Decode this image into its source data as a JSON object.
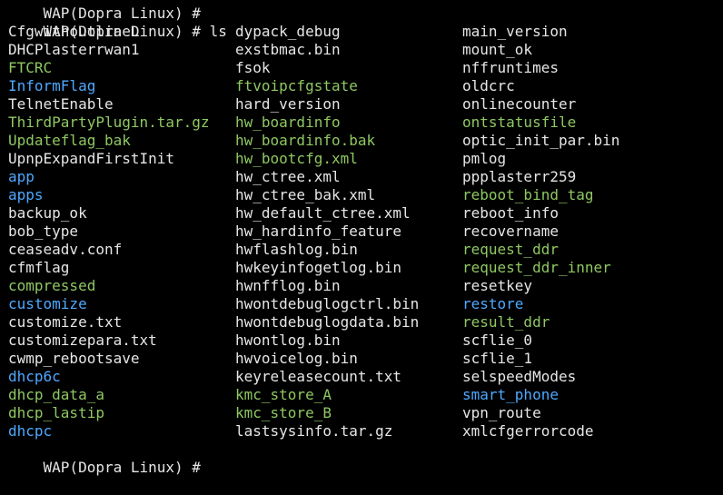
{
  "terminal": {
    "first_prompt": "WAP(Dopra Linux) # ",
    "prompt": "WAP(Dopra Linux) # ",
    "command": "ls",
    "last_prompt": "WAP(Dopra Linux) # ",
    "colors": {
      "background": "#000000",
      "foreground": "#e6e6e6",
      "directory": "#4fa8ff",
      "executable": "#8fc862"
    },
    "rows": [
      [
        {
          "name": "CfgwithoutlineD",
          "kind": "plain"
        },
        {
          "name": "dypack_debug",
          "kind": "plain"
        },
        {
          "name": "main_version",
          "kind": "plain"
        }
      ],
      [
        {
          "name": "DHCPlasterrwan1",
          "kind": "plain"
        },
        {
          "name": "exstbmac.bin",
          "kind": "plain"
        },
        {
          "name": "mount_ok",
          "kind": "plain"
        }
      ],
      [
        {
          "name": "FTCRC",
          "kind": "exe"
        },
        {
          "name": "fsok",
          "kind": "plain"
        },
        {
          "name": "nffruntimes",
          "kind": "plain"
        }
      ],
      [
        {
          "name": "InformFlag",
          "kind": "dir"
        },
        {
          "name": "ftvoipcfgstate",
          "kind": "exe"
        },
        {
          "name": "oldcrc",
          "kind": "plain"
        }
      ],
      [
        {
          "name": "TelnetEnable",
          "kind": "plain"
        },
        {
          "name": "hard_version",
          "kind": "plain"
        },
        {
          "name": "onlinecounter",
          "kind": "plain"
        }
      ],
      [
        {
          "name": "ThirdPartyPlugin.tar.gz",
          "kind": "exe"
        },
        {
          "name": "hw_boardinfo",
          "kind": "exe"
        },
        {
          "name": "ontstatusfile",
          "kind": "exe"
        }
      ],
      [
        {
          "name": "Updateflag_bak",
          "kind": "exe"
        },
        {
          "name": "hw_boardinfo.bak",
          "kind": "exe"
        },
        {
          "name": "optic_init_par.bin",
          "kind": "plain"
        }
      ],
      [
        {
          "name": "UpnpExpandFirstInit",
          "kind": "plain"
        },
        {
          "name": "hw_bootcfg.xml",
          "kind": "exe"
        },
        {
          "name": "pmlog",
          "kind": "plain"
        }
      ],
      [
        {
          "name": "app",
          "kind": "dir"
        },
        {
          "name": "hw_ctree.xml",
          "kind": "plain"
        },
        {
          "name": "ppplasterr259",
          "kind": "plain"
        }
      ],
      [
        {
          "name": "apps",
          "kind": "dir"
        },
        {
          "name": "hw_ctree_bak.xml",
          "kind": "plain"
        },
        {
          "name": "reboot_bind_tag",
          "kind": "exe"
        }
      ],
      [
        {
          "name": "backup_ok",
          "kind": "plain"
        },
        {
          "name": "hw_default_ctree.xml",
          "kind": "plain"
        },
        {
          "name": "reboot_info",
          "kind": "plain"
        }
      ],
      [
        {
          "name": "bob_type",
          "kind": "plain"
        },
        {
          "name": "hw_hardinfo_feature",
          "kind": "plain"
        },
        {
          "name": "recovername",
          "kind": "plain"
        }
      ],
      [
        {
          "name": "ceaseadv.conf",
          "kind": "plain"
        },
        {
          "name": "hwflashlog.bin",
          "kind": "plain"
        },
        {
          "name": "request_ddr",
          "kind": "exe"
        }
      ],
      [
        {
          "name": "cfmflag",
          "kind": "plain"
        },
        {
          "name": "hwkeyinfogetlog.bin",
          "kind": "plain"
        },
        {
          "name": "request_ddr_inner",
          "kind": "exe"
        }
      ],
      [
        {
          "name": "compressed",
          "kind": "exe"
        },
        {
          "name": "hwnfflog.bin",
          "kind": "plain"
        },
        {
          "name": "resetkey",
          "kind": "plain"
        }
      ],
      [
        {
          "name": "customize",
          "kind": "dir"
        },
        {
          "name": "hwontdebuglogctrl.bin",
          "kind": "plain"
        },
        {
          "name": "restore",
          "kind": "dir"
        }
      ],
      [
        {
          "name": "customize.txt",
          "kind": "plain"
        },
        {
          "name": "hwontdebuglogdata.bin",
          "kind": "plain"
        },
        {
          "name": "result_ddr",
          "kind": "exe"
        }
      ],
      [
        {
          "name": "customizepara.txt",
          "kind": "plain"
        },
        {
          "name": "hwontlog.bin",
          "kind": "plain"
        },
        {
          "name": "scflie_0",
          "kind": "plain"
        }
      ],
      [
        {
          "name": "cwmp_rebootsave",
          "kind": "plain"
        },
        {
          "name": "hwvoicelog.bin",
          "kind": "plain"
        },
        {
          "name": "scflie_1",
          "kind": "plain"
        }
      ],
      [
        {
          "name": "dhcp6c",
          "kind": "dir"
        },
        {
          "name": "keyreleasecount.txt",
          "kind": "plain"
        },
        {
          "name": "selspeedModes",
          "kind": "plain"
        }
      ],
      [
        {
          "name": "dhcp_data_a",
          "kind": "exe"
        },
        {
          "name": "kmc_store_A",
          "kind": "exe"
        },
        {
          "name": "smart_phone",
          "kind": "dir"
        }
      ],
      [
        {
          "name": "dhcp_lastip",
          "kind": "exe"
        },
        {
          "name": "kmc_store_B",
          "kind": "exe"
        },
        {
          "name": "vpn_route",
          "kind": "plain"
        }
      ],
      [
        {
          "name": "dhcpc",
          "kind": "dir"
        },
        {
          "name": "lastsysinfo.tar.gz",
          "kind": "plain"
        },
        {
          "name": "xmlcfgerrorcode",
          "kind": "plain"
        }
      ]
    ]
  }
}
